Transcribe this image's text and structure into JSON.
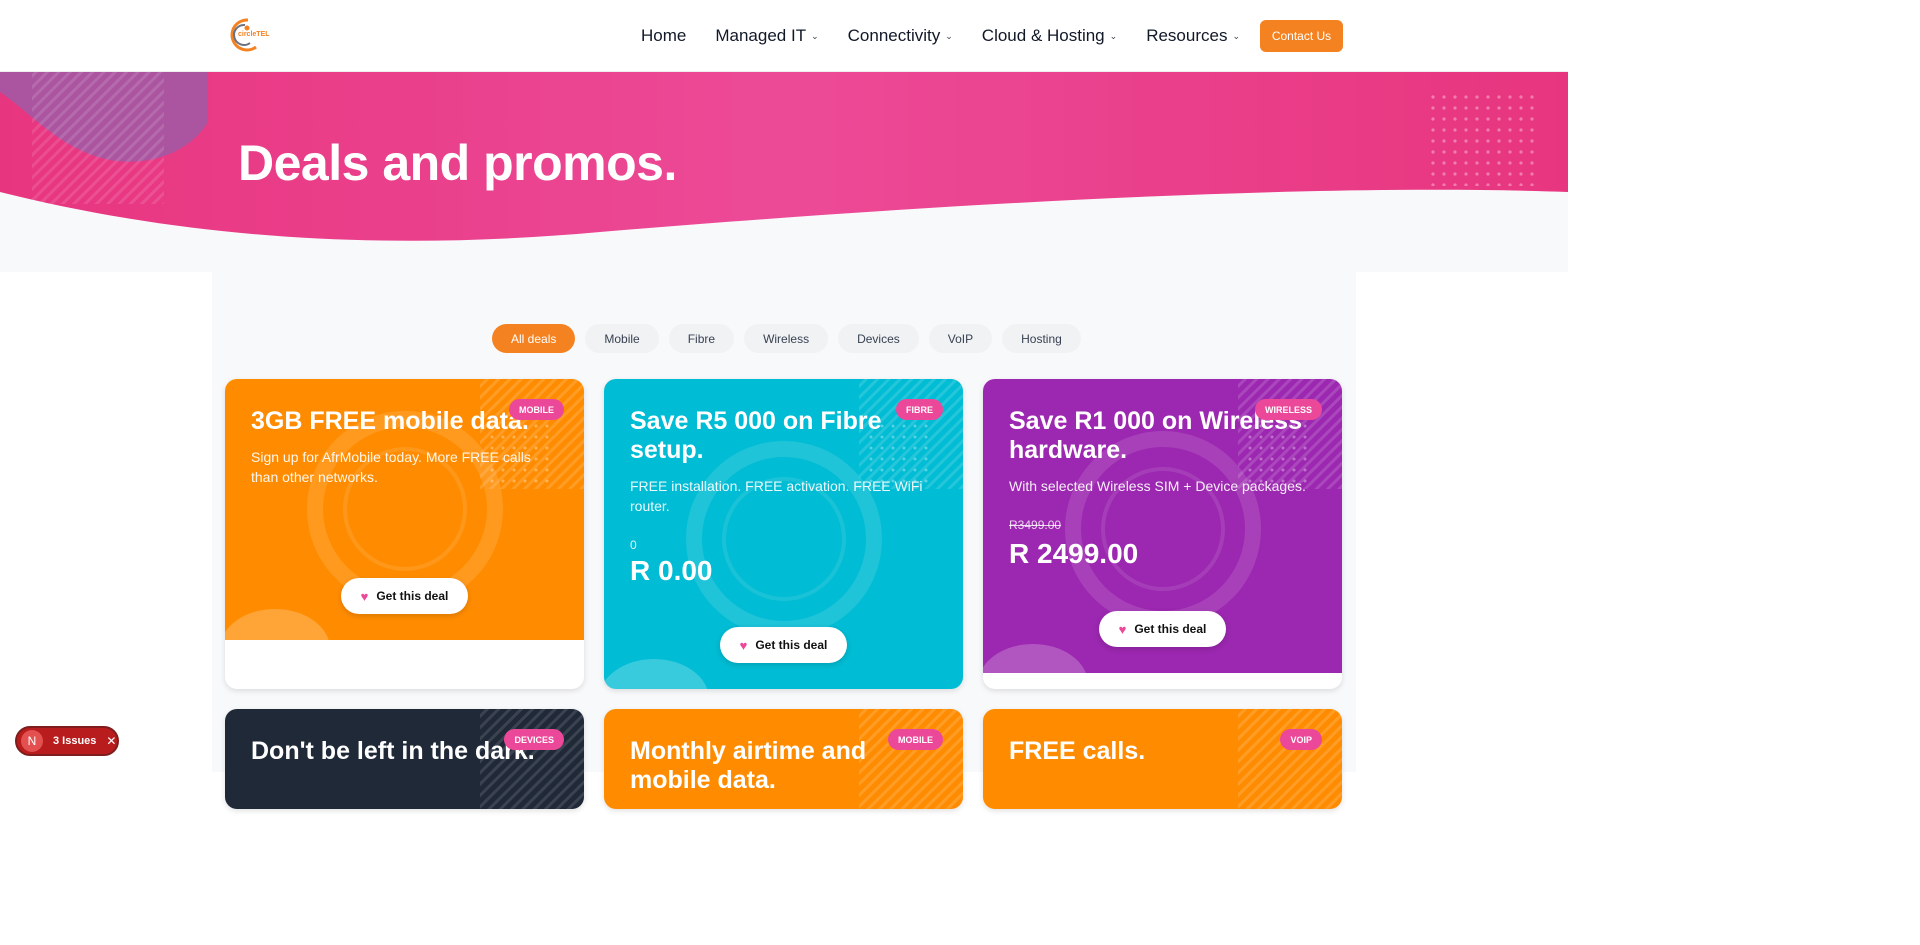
{
  "header": {
    "logo_text": "circleTEL",
    "nav": [
      {
        "label": "Home",
        "dropdown": false
      },
      {
        "label": "Managed IT",
        "dropdown": true
      },
      {
        "label": "Connectivity",
        "dropdown": true
      },
      {
        "label": "Cloud & Hosting",
        "dropdown": true
      },
      {
        "label": "Resources",
        "dropdown": true
      }
    ],
    "contact_label": "Contact Us"
  },
  "hero": {
    "title": "Deals and promos."
  },
  "filters": {
    "active": "All deals",
    "items": [
      "All deals",
      "Mobile",
      "Fibre",
      "Wireless",
      "Devices",
      "VoIP",
      "Hosting"
    ]
  },
  "cards": [
    {
      "title": "3GB FREE mobile data.",
      "badge": "MOBILE",
      "description": "Sign up for AfrMobile today. More FREE calls than other networks.",
      "button": "Get this deal",
      "color": "#ff8c00"
    },
    {
      "title": "Save R5 000 on Fibre setup.",
      "badge": "FIBRE",
      "description": "FREE installation. FREE activation. FREE WiFi router.",
      "small_value": "0",
      "price": "R 0.00",
      "button": "Get this deal",
      "color": "#00bcd4"
    },
    {
      "title": "Save R1 000 on Wireless hardware.",
      "badge": "WIRELESS",
      "description": "With selected Wireless SIM + Device packages.",
      "old_price": "R3499.00",
      "price": "R 2499.00",
      "button": "Get this deal",
      "color": "#9c27b0"
    },
    {
      "title": "Don't be left in the dark.",
      "badge": "DEVICES",
      "color": "#1f2937"
    },
    {
      "title": "Monthly airtime and mobile data.",
      "badge": "MOBILE",
      "color": "#ff8c00"
    },
    {
      "title": "FREE calls.",
      "badge": "VOIP",
      "color": "#ff8c00"
    }
  ],
  "issues": {
    "logo": "N",
    "label": "3 Issues",
    "close": "✕"
  }
}
